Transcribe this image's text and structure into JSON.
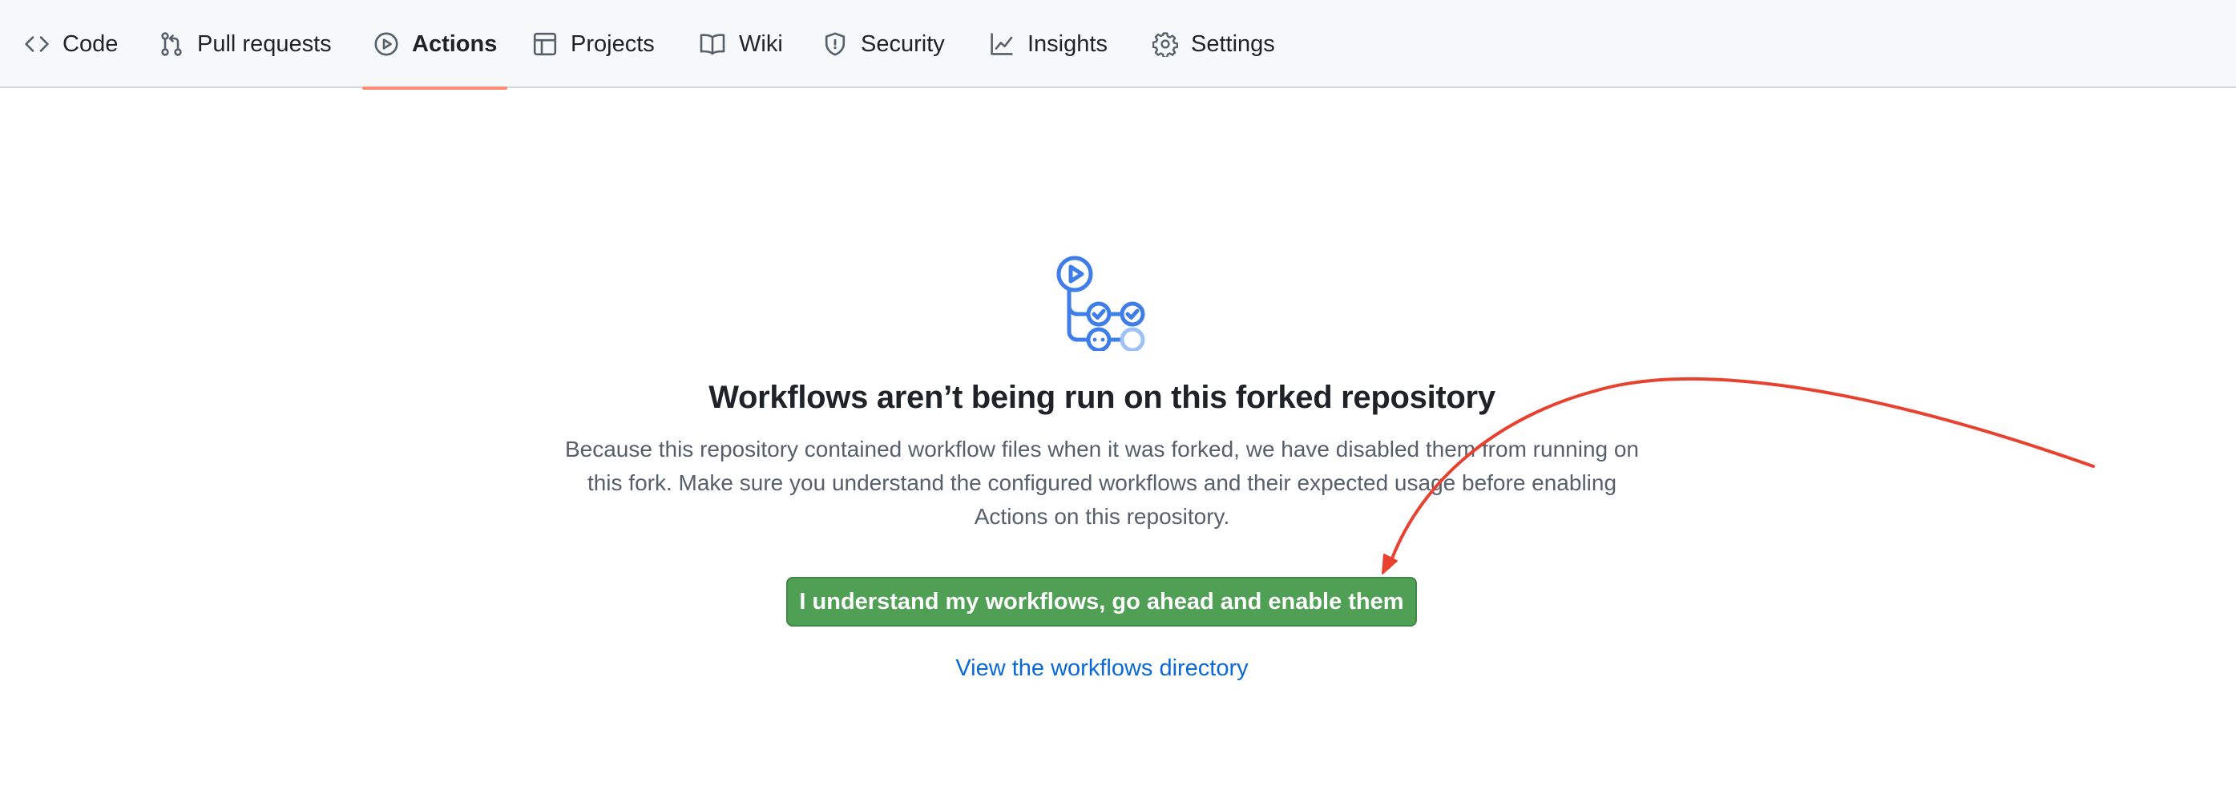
{
  "repo_nav": {
    "tabs": [
      {
        "label": "Code",
        "icon": "code-icon"
      },
      {
        "label": "Pull requests",
        "icon": "git-pull-request-icon"
      },
      {
        "label": "Actions",
        "icon": "play-icon",
        "active": true
      },
      {
        "label": "Projects",
        "icon": "table-icon"
      },
      {
        "label": "Wiki",
        "icon": "book-icon"
      },
      {
        "label": "Security",
        "icon": "shield-icon"
      },
      {
        "label": "Insights",
        "icon": "graph-icon"
      },
      {
        "label": "Settings",
        "icon": "gear-icon"
      }
    ]
  },
  "blankslate": {
    "icon": "workflow-icon",
    "title": "Workflows aren’t being run on this forked repository",
    "description": "Because this repository contained workflow files when it was forked, we have disabled them from running on this fork. Make sure you understand the configured workflows and their expected usage before enabling Actions on this repository.",
    "enable_button_label": "I understand my workflows, go ahead and enable them",
    "directory_link_label": "View the workflows directory"
  },
  "colors": {
    "accent_underline": "#fd8c73",
    "primary_button": "#4fa055",
    "link": "#0969da",
    "annotation_arrow": "#e8412f",
    "workflow_icon": "#3f7ee8"
  }
}
